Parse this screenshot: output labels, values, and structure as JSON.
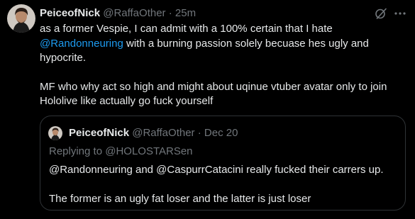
{
  "tweet": {
    "author_name": "PeiceofNick",
    "handle": "@RaffaOther",
    "separator": "·",
    "time": "25m",
    "avatar_icon": "user-avatar",
    "grok_icon": "grok-icon",
    "more_icon": "more-options-icon",
    "paragraphs": [
      {
        "pre": "as a former Vespie, I can admit with a 100% certain that I hate ",
        "mention": "@Randonneuring",
        "post": " with a burning passion solely becuase hes ugly and hypocrite."
      },
      {
        "text": "MF who why act so high and might about uqinue vtuber avatar only to join Hololive like actually go fuck yourself"
      }
    ]
  },
  "quote": {
    "author_name": "PeiceofNick",
    "handle": "@RaffaOther",
    "separator": "·",
    "time": "Dec 20",
    "replying_to": "Replying to @HOLOSTARSen",
    "paragraphs": [
      "@Randonneuring and @CaspurrCatacini really fucked their carrers up.",
      "The former is an ugly fat loser and the latter is just loser"
    ]
  },
  "colors": {
    "background": "#000000",
    "text": "#e7e9ea",
    "secondary": "#71767b",
    "link": "#1d9bf0",
    "border": "#2f3336"
  }
}
